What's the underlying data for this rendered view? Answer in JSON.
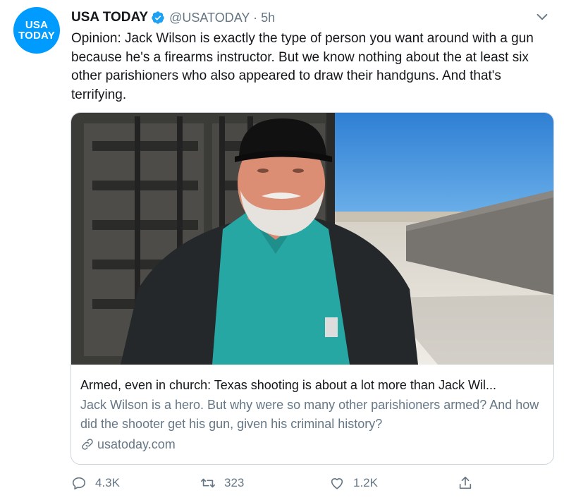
{
  "account": {
    "avatar_line1": "USA",
    "avatar_line2": "TODAY",
    "display_name": "USA TODAY",
    "handle_time": "@USATODAY · 5h"
  },
  "tweet": {
    "text": "Opinion: Jack Wilson is exactly the type of person you want around with a gun because he's a firearms instructor. But we know nothing about the at least six other parishioners who also appeared to draw their handguns. And that's terrifying."
  },
  "card": {
    "title": "Armed, even in church: Texas shooting is about a lot more than Jack Wil...",
    "description": "Jack Wilson is a hero. But why were so many other parishioners armed? And how did the shooter get his gun, given his criminal history?",
    "domain": "usatoday.com"
  },
  "actions": {
    "reply_count": "4.3K",
    "retweet_count": "323",
    "like_count": "1.2K"
  },
  "colors": {
    "brand_blue": "#009bff",
    "verified_blue": "#1da1f2",
    "secondary_text": "#657786"
  },
  "icons": [
    "verified-icon",
    "chevron-down-icon",
    "link-icon",
    "reply-icon",
    "retweet-icon",
    "like-icon",
    "share-icon"
  ]
}
